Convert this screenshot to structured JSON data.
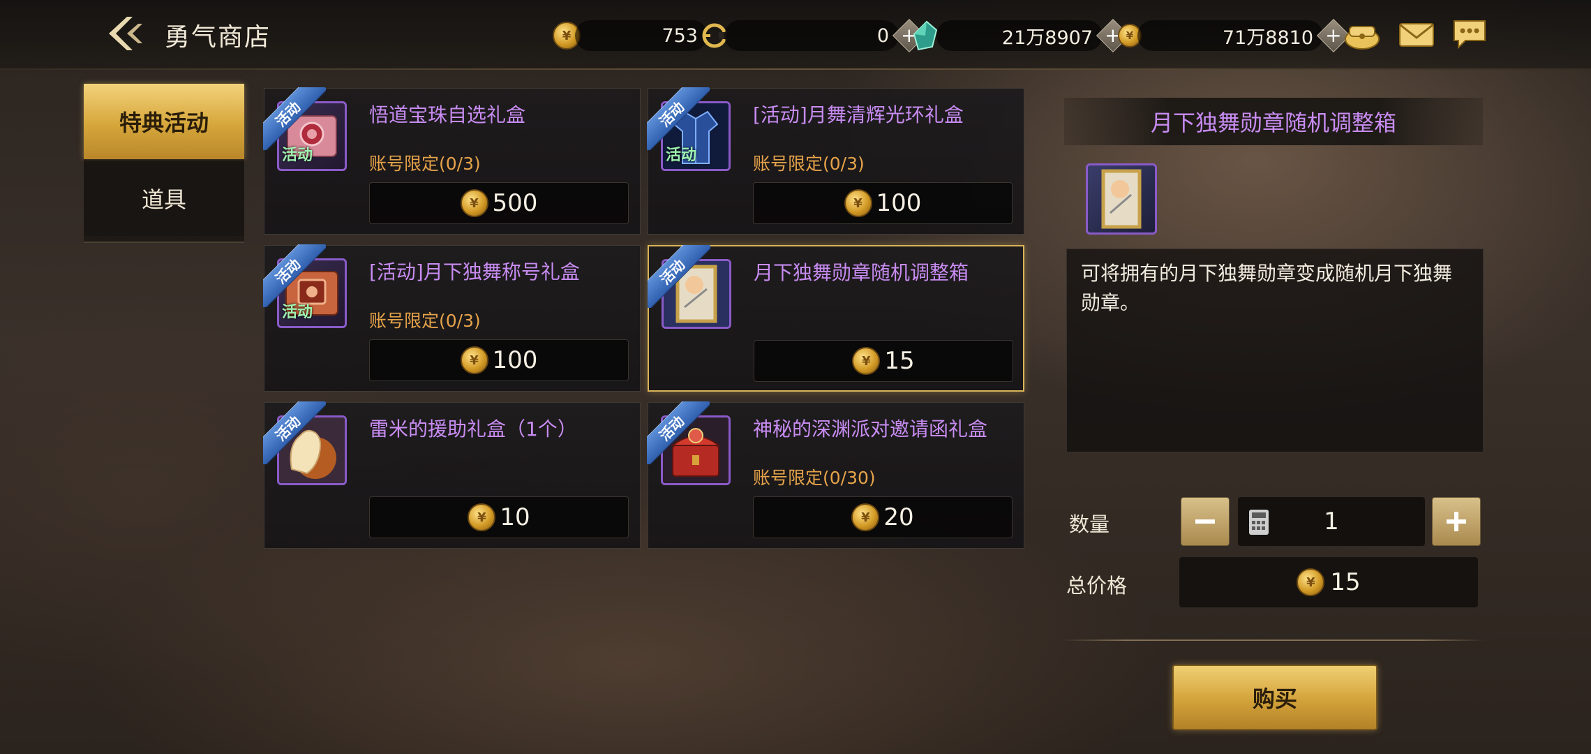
{
  "header": {
    "title": "勇气商店",
    "currencies": [
      {
        "name": "coin-gold",
        "value": "753",
        "has_plus": false
      },
      {
        "name": "c-token",
        "value": "0",
        "has_plus": true
      },
      {
        "name": "green-gem",
        "value": "21万8907",
        "has_plus": true
      },
      {
        "name": "gold-coin-2",
        "value": "71万8810",
        "has_plus": true
      }
    ]
  },
  "tabs": [
    {
      "label": "特典活动",
      "active": true
    },
    {
      "label": "道具",
      "active": false
    }
  ],
  "badge_text": "活动",
  "items": [
    {
      "name": "悟道宝珠自选礼盒",
      "limit_label": "账号限定",
      "limit": "(0/3)",
      "price": "500",
      "icon_label": "活动",
      "icon": "pink-book-icon"
    },
    {
      "name": "[活动]月舞清辉光环礼盒",
      "limit_label": "账号限定",
      "limit": "(0/3)",
      "price": "100",
      "icon_label": "活动",
      "icon": "blue-outfit-icon"
    },
    {
      "name": "[活动]月下独舞称号礼盒",
      "limit_label": "账号限定",
      "limit": "(0/3)",
      "price": "100",
      "icon_label": "活动",
      "icon": "red-book-icon"
    },
    {
      "name": "月下独舞勋章随机调整箱",
      "limit_label": "",
      "limit": "",
      "price": "15",
      "icon_label": "",
      "icon": "medal-scroll-icon"
    },
    {
      "name": "雷米的援助礼盒（1个）",
      "limit_label": "",
      "limit": "",
      "price": "10",
      "icon_label": "",
      "icon": "glove-icon"
    },
    {
      "name": "神秘的深渊派对邀请函礼盒",
      "limit_label": "账号限定",
      "limit": "(0/30)",
      "price": "20",
      "icon_label": "",
      "icon": "red-chest-icon"
    }
  ],
  "detail": {
    "title": "月下独舞勋章随机调整箱",
    "description": "可将拥有的月下独舞勋章变成随机月下独舞勋章。",
    "quantity_label": "数量",
    "quantity": "1",
    "total_label": "总价格",
    "total": "15",
    "buy_label": "购买"
  },
  "colors": {
    "accent_gold": "#d9b458",
    "item_name_purple": "#c88cf2",
    "limit_orange": "#e6a34a",
    "badge_blue": "#3f6fbe"
  }
}
